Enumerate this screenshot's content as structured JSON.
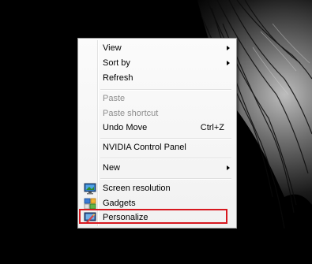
{
  "context_menu": {
    "items": [
      {
        "label": "View",
        "submenu": true
      },
      {
        "label": "Sort by",
        "submenu": true
      },
      {
        "label": "Refresh"
      },
      {
        "label": "Paste",
        "disabled": true
      },
      {
        "label": "Paste shortcut",
        "disabled": true
      },
      {
        "label": "Undo Move",
        "shortcut": "Ctrl+Z"
      },
      {
        "label": "NVIDIA Control Panel"
      },
      {
        "label": "New",
        "submenu": true
      },
      {
        "label": "Screen resolution",
        "icon": "monitor-icon"
      },
      {
        "label": "Gadgets",
        "icon": "gadgets-icon"
      },
      {
        "label": "Personalize",
        "icon": "personalize-icon",
        "highlighted": true
      }
    ]
  },
  "colors": {
    "highlight_box": "#d7181f",
    "disabled_text": "#8d8d8d",
    "menu_background": "#f1f1f1"
  }
}
